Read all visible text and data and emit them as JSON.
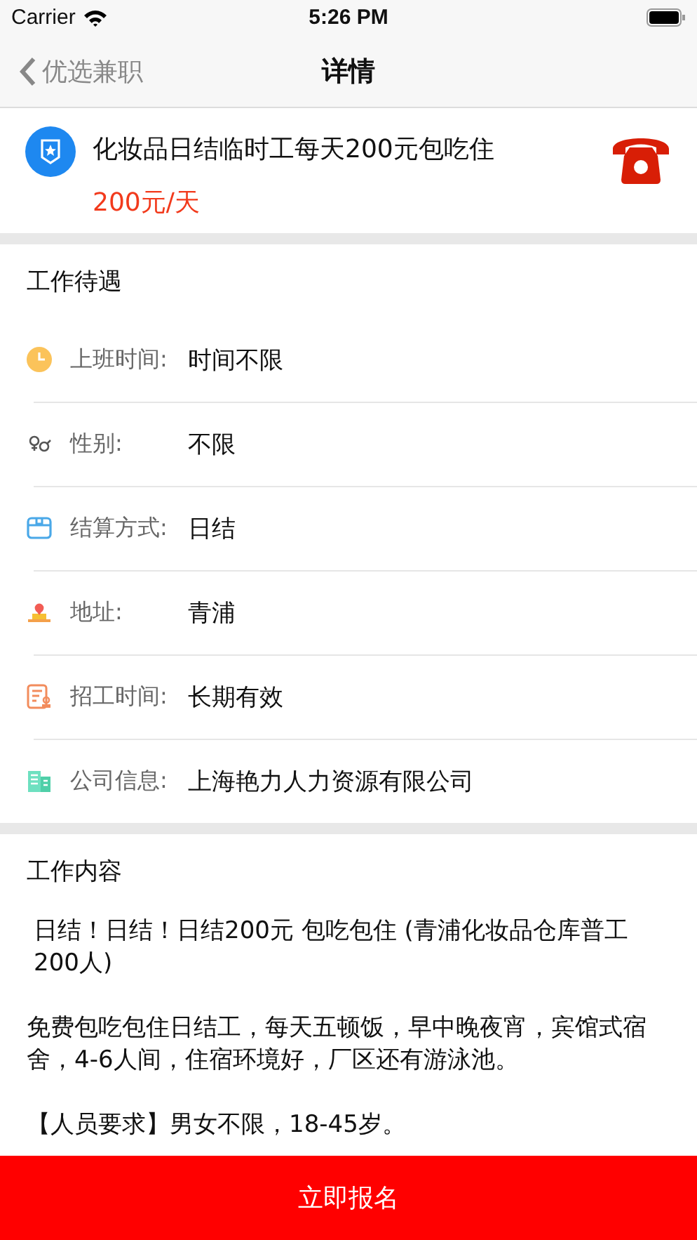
{
  "status_bar": {
    "carrier": "Carrier",
    "time": "5:26 PM"
  },
  "nav": {
    "back": "优选兼职",
    "title": "详情"
  },
  "job": {
    "title": "化妆品日结临时工每天200元包吃住",
    "pay": "200元/天"
  },
  "benefits": {
    "heading": "工作待遇",
    "rows": [
      {
        "label": "上班时间:",
        "value": "时间不限"
      },
      {
        "label": "性别:",
        "value": "不限"
      },
      {
        "label": "结算方式:",
        "value": "日结"
      },
      {
        "label": "地址:",
        "value": "青浦"
      },
      {
        "label": "招工时间:",
        "value": "长期有效"
      },
      {
        "label": "公司信息:",
        "value": "上海艳力人力资源有限公司"
      }
    ]
  },
  "content": {
    "heading": "工作内容",
    "paragraphs": [
      "日结！日结！日结200元  包吃包住 (青浦化妆品仓库普工200人)",
      "免费包吃包住日结工，每天五顿饭，早中晚夜宵，宾馆式宿舍，4-6人间，住宿环境好，厂区还有游泳池。",
      "【人员要求】男女不限，18-45岁。"
    ]
  },
  "apply_button": "立即报名"
}
